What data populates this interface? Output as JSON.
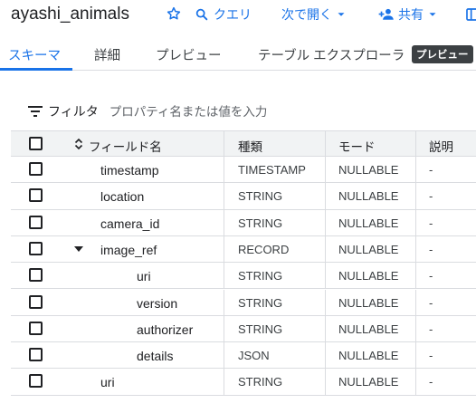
{
  "header": {
    "title": "ayashi_animals",
    "query_label": "クエリ",
    "open_label": "次で開く",
    "share_label": "共有"
  },
  "tabs": [
    {
      "label": "スキーマ",
      "active": true
    },
    {
      "label": "詳細",
      "active": false
    },
    {
      "label": "プレビュー",
      "active": false
    },
    {
      "label": "テーブル エクスプローラ",
      "active": false
    }
  ],
  "preview_badge": "プレビュー",
  "filter": {
    "label": "フィルタ",
    "placeholder": "プロパティ名または値を入力"
  },
  "table": {
    "columns": [
      "フィールド名",
      "種類",
      "モード",
      "説明"
    ],
    "rows": [
      {
        "name": "timestamp",
        "type": "TIMESTAMP",
        "mode": "NULLABLE",
        "description": "-",
        "indent": 1,
        "expandable": false
      },
      {
        "name": "location",
        "type": "STRING",
        "mode": "NULLABLE",
        "description": "-",
        "indent": 1,
        "expandable": false
      },
      {
        "name": "camera_id",
        "type": "STRING",
        "mode": "NULLABLE",
        "description": "-",
        "indent": 1,
        "expandable": false
      },
      {
        "name": "image_ref",
        "type": "RECORD",
        "mode": "NULLABLE",
        "description": "-",
        "indent": 1,
        "expandable": true
      },
      {
        "name": "uri",
        "type": "STRING",
        "mode": "NULLABLE",
        "description": "-",
        "indent": 2,
        "expandable": false
      },
      {
        "name": "version",
        "type": "STRING",
        "mode": "NULLABLE",
        "description": "-",
        "indent": 2,
        "expandable": false
      },
      {
        "name": "authorizer",
        "type": "STRING",
        "mode": "NULLABLE",
        "description": "-",
        "indent": 2,
        "expandable": false
      },
      {
        "name": "details",
        "type": "JSON",
        "mode": "NULLABLE",
        "description": "-",
        "indent": 2,
        "expandable": false
      },
      {
        "name": "uri",
        "type": "STRING",
        "mode": "NULLABLE",
        "description": "-",
        "indent": 1,
        "expandable": false
      }
    ]
  },
  "colors": {
    "accent": "#1a73e8",
    "text": "#202124",
    "header_bg": "#f1f3f4",
    "border": "#dadce0"
  }
}
